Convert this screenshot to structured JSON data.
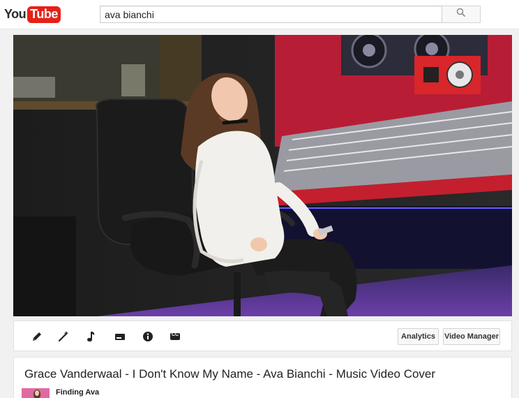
{
  "header": {
    "logo_you": "You",
    "logo_tube": "Tube",
    "search_value": "ava bianchi"
  },
  "toolbar": {
    "analytics_label": "Analytics",
    "video_manager_label": "Video Manager",
    "cc_label": "CC"
  },
  "video": {
    "title": "Grace Vanderwaal - I Don't Know My Name - Ava Bianchi - Music Video Cover",
    "channel_name": "Finding Ava"
  },
  "colors": {
    "brand_red": "#e62117",
    "studio_red": "#d61e2a"
  },
  "icons": [
    "search-icon",
    "pencil-icon",
    "magic-wand-icon",
    "music-note-icon",
    "card-icon",
    "info-icon",
    "cc-icon"
  ]
}
